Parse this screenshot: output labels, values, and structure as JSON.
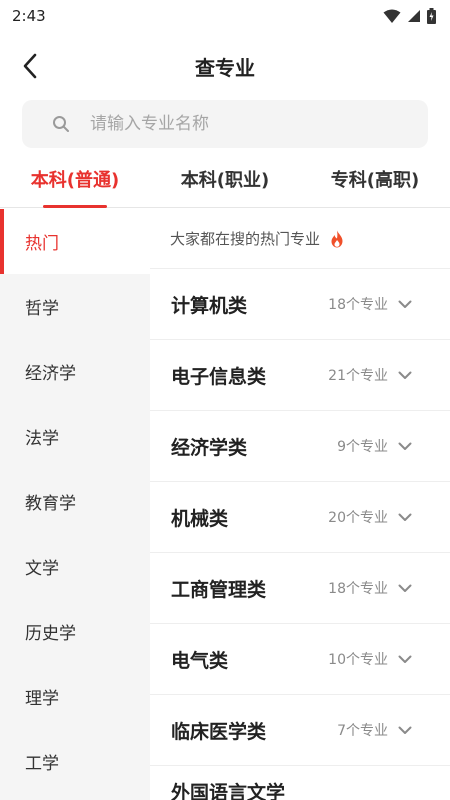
{
  "status": {
    "time": "2:43"
  },
  "header": {
    "title": "查专业"
  },
  "search": {
    "placeholder": "请输入专业名称"
  },
  "tabs": [
    {
      "label": "本科(普通)",
      "active": true
    },
    {
      "label": "本科(职业)",
      "active": false
    },
    {
      "label": "专科(高职)",
      "active": false
    }
  ],
  "sidebar": {
    "items": [
      {
        "label": "热门",
        "active": true
      },
      {
        "label": "哲学"
      },
      {
        "label": "经济学"
      },
      {
        "label": "法学"
      },
      {
        "label": "教育学"
      },
      {
        "label": "文学"
      },
      {
        "label": "历史学"
      },
      {
        "label": "理学"
      },
      {
        "label": "工学"
      }
    ]
  },
  "content": {
    "hot_title": "大家都在搜的热门专业",
    "majors": [
      {
        "name": "计算机类",
        "count": "18个专业"
      },
      {
        "name": "电子信息类",
        "count": "21个专业"
      },
      {
        "name": "经济学类",
        "count": "9个专业"
      },
      {
        "name": "机械类",
        "count": "20个专业"
      },
      {
        "name": "工商管理类",
        "count": "18个专业"
      },
      {
        "name": "电气类",
        "count": "10个专业"
      },
      {
        "name": "临床医学类",
        "count": "7个专业"
      },
      {
        "name": "外国语言文学",
        "count": ""
      }
    ]
  },
  "colors": {
    "accent": "#e8322e",
    "sidebar_bg": "#f5f5f5",
    "search_bg": "#f4f4f4"
  },
  "icons": [
    "wifi-icon",
    "signal-icon",
    "battery-icon",
    "back-arrow-icon",
    "search-icon",
    "fire-icon",
    "chevron-down-icon"
  ]
}
